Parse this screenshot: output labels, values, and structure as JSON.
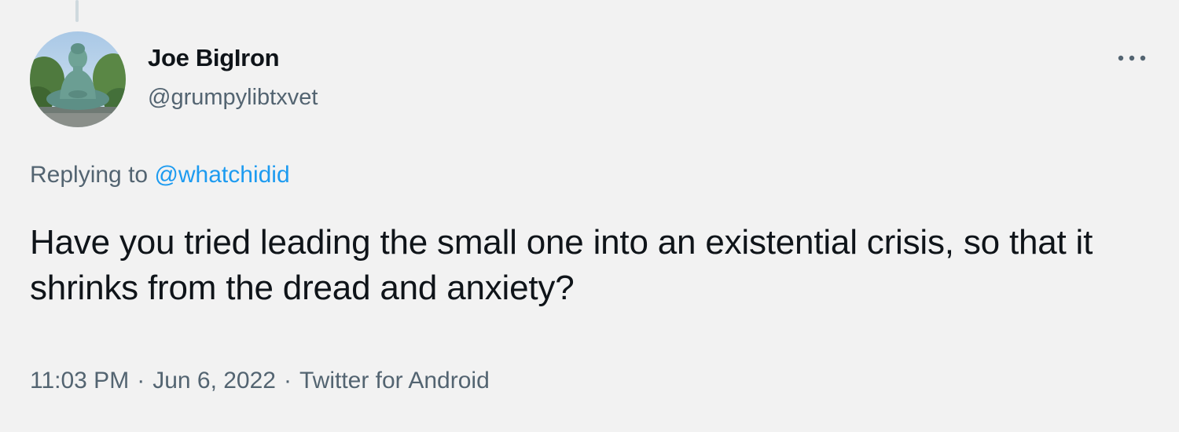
{
  "author": {
    "display_name": "Joe BigIron",
    "handle": "@grumpylibtxvet",
    "avatar_icon": "buddha-statue-photo"
  },
  "reply_context": {
    "prefix": "Replying to",
    "mention": "@whatchidid"
  },
  "tweet": {
    "text": "Have you tried leading the small one into an existential crisis, so that it shrinks from the dread and anxiety?"
  },
  "meta": {
    "time": "11:03 PM",
    "separator": "·",
    "date": "Jun 6, 2022",
    "source": "Twitter for Android"
  },
  "icons": {
    "more": "more-horizontal-icon"
  },
  "colors": {
    "background": "#f2f2f2",
    "text_primary": "#0f1419",
    "text_secondary": "#536471",
    "accent_link": "#1d9bf0"
  }
}
